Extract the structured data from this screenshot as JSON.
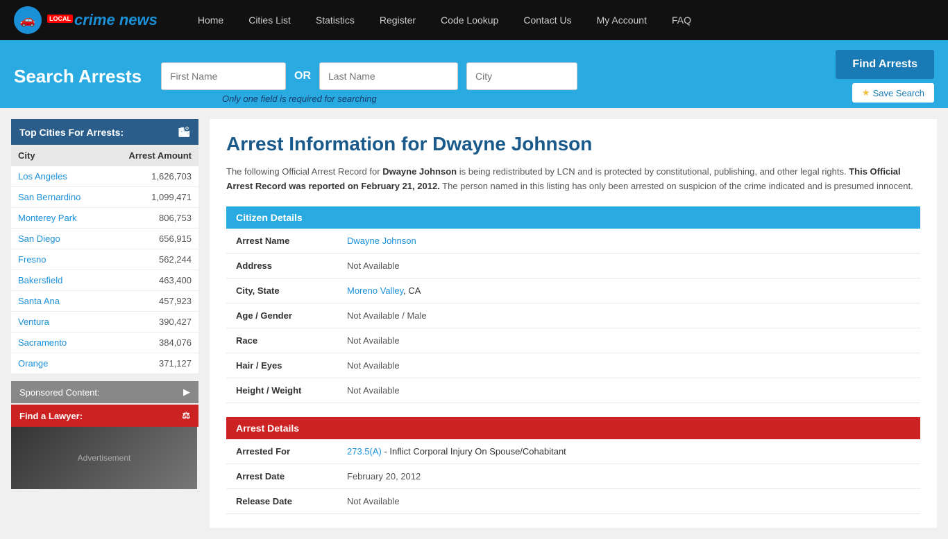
{
  "nav": {
    "logo_text": "crime news",
    "logo_local": "LOCAL",
    "links": [
      {
        "label": "Home",
        "id": "home"
      },
      {
        "label": "Cities List",
        "id": "cities-list"
      },
      {
        "label": "Statistics",
        "id": "statistics"
      },
      {
        "label": "Register",
        "id": "register"
      },
      {
        "label": "Code Lookup",
        "id": "code-lookup"
      },
      {
        "label": "Contact Us",
        "id": "contact-us"
      },
      {
        "label": "My Account",
        "id": "my-account"
      },
      {
        "label": "FAQ",
        "id": "faq"
      }
    ]
  },
  "search": {
    "title": "Search Arrests",
    "first_name_placeholder": "First Name",
    "last_name_placeholder": "Last Name",
    "city_placeholder": "City",
    "or_text": "OR",
    "note": "Only one field is required for searching",
    "find_arrests_label": "Find Arrests",
    "save_search_label": "Save Search"
  },
  "sidebar": {
    "top_cities_header": "Top Cities For Arrests:",
    "columns": {
      "city": "City",
      "amount": "Arrest Amount"
    },
    "cities": [
      {
        "name": "Los Angeles",
        "amount": "1,626,703"
      },
      {
        "name": "San Bernardino",
        "amount": "1,099,471"
      },
      {
        "name": "Monterey Park",
        "amount": "806,753"
      },
      {
        "name": "San Diego",
        "amount": "656,915"
      },
      {
        "name": "Fresno",
        "amount": "562,244"
      },
      {
        "name": "Bakersfield",
        "amount": "463,400"
      },
      {
        "name": "Santa Ana",
        "amount": "457,923"
      },
      {
        "name": "Ventura",
        "amount": "390,427"
      },
      {
        "name": "Sacramento",
        "amount": "384,076"
      },
      {
        "name": "Orange",
        "amount": "371,127"
      }
    ],
    "sponsored_label": "Sponsored Content:",
    "find_lawyer_label": "Find a Lawyer:"
  },
  "content": {
    "title": "Arrest Information for Dwayne Johnson",
    "intro_part1": "The following Official Arrest Record for ",
    "subject_name": "Dwayne Johnson",
    "intro_part2": " is being redistributed by LCN and is protected by constitutional, publishing, and other legal rights. ",
    "report_date_text": "This Official Arrest Record was reported on February 21, 2012.",
    "intro_part3": " The person named in this listing has only been arrested on suspicion of the crime indicated and is presumed innocent.",
    "citizen_details_header": "Citizen Details",
    "arrest_details_header": "Arrest Details",
    "fields": {
      "arrest_name_label": "Arrest Name",
      "arrest_name_value": "Dwayne Johnson",
      "address_label": "Address",
      "address_value": "Not Available",
      "city_state_label": "City, State",
      "city_value": "Moreno Valley",
      "state_value": ", CA",
      "age_gender_label": "Age / Gender",
      "age_gender_value": "Not Available / Male",
      "race_label": "Race",
      "race_value": "Not Available",
      "hair_eyes_label": "Hair / Eyes",
      "hair_eyes_value": "Not Available",
      "height_weight_label": "Height / Weight",
      "height_weight_value": "Not Available",
      "arrested_for_label": "Arrested For",
      "arrested_for_code": "273.5(A)",
      "arrested_for_desc": " - Inflict Corporal Injury On Spouse/Cohabitant",
      "arrest_date_label": "Arrest Date",
      "arrest_date_value": "February 20, 2012",
      "release_date_label": "Release Date",
      "release_date_value": "Not Available"
    }
  }
}
